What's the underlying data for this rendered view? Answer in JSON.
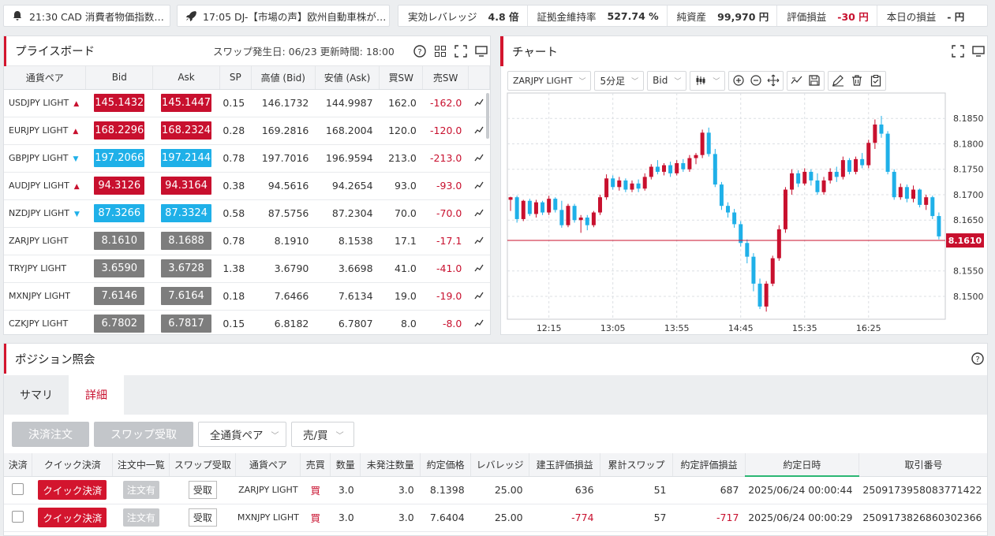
{
  "top": {
    "news1": "21:30 CAD 消費者物価指数…",
    "news2": "17:05 DJ-【市場の声】欧州自動車株が…",
    "stats": [
      {
        "label": "実効レバレッジ",
        "value": "4.8 倍"
      },
      {
        "label": "証拠金維持率",
        "value": "527.74 %"
      },
      {
        "label": "純資産",
        "value": "99,970 円"
      },
      {
        "label": "評価損益",
        "value": "-30 円"
      },
      {
        "label": "本日の損益",
        "value": "- 円"
      }
    ]
  },
  "priceboard": {
    "title": "プライスボード",
    "info": "スワップ発生日: 06/23 更新時間: 18:00",
    "headers": [
      "通貨ペア",
      "Bid",
      "Ask",
      "SP",
      "高値 (Bid)",
      "安値 (Ask)",
      "買SW",
      "売SW",
      ""
    ],
    "rows": [
      {
        "pair": "USDJPY LIGHT",
        "dir": "up",
        "bid": "145.1432",
        "ask": "145.1447",
        "sp": "0.15",
        "high": "146.1732",
        "low": "144.9987",
        "buysw": "162.0",
        "sellsw": "-162.0"
      },
      {
        "pair": "EURJPY LIGHT",
        "dir": "up",
        "bid": "168.2296",
        "ask": "168.2324",
        "sp": "0.28",
        "high": "169.2816",
        "low": "168.2004",
        "buysw": "120.0",
        "sellsw": "-120.0"
      },
      {
        "pair": "GBPJPY LIGHT",
        "dir": "dn",
        "bid": "197.2066",
        "ask": "197.2144",
        "sp": "0.78",
        "high": "197.7016",
        "low": "196.9594",
        "buysw": "213.0",
        "sellsw": "-213.0"
      },
      {
        "pair": "AUDJPY LIGHT",
        "dir": "up",
        "bid": "94.3126",
        "ask": "94.3164",
        "sp": "0.38",
        "high": "94.5616",
        "low": "94.2654",
        "buysw": "93.0",
        "sellsw": "-93.0"
      },
      {
        "pair": "NZDJPY LIGHT",
        "dir": "dn",
        "bid": "87.3266",
        "ask": "87.3324",
        "sp": "0.58",
        "high": "87.5756",
        "low": "87.2304",
        "buysw": "70.0",
        "sellsw": "-70.0"
      },
      {
        "pair": "ZARJPY LIGHT",
        "dir": "nt",
        "bid": "8.1610",
        "ask": "8.1688",
        "sp": "0.78",
        "high": "8.1910",
        "low": "8.1538",
        "buysw": "17.1",
        "sellsw": "-17.1"
      },
      {
        "pair": "TRYJPY LIGHT",
        "dir": "nt",
        "bid": "3.6590",
        "ask": "3.6728",
        "sp": "1.38",
        "high": "3.6790",
        "low": "3.6698",
        "buysw": "41.0",
        "sellsw": "-41.0"
      },
      {
        "pair": "MXNJPY LIGHT",
        "dir": "nt",
        "bid": "7.6146",
        "ask": "7.6164",
        "sp": "0.18",
        "high": "7.6466",
        "low": "7.6134",
        "buysw": "19.0",
        "sellsw": "-19.0"
      },
      {
        "pair": "CZKJPY LIGHT",
        "dir": "nt",
        "bid": "6.7802",
        "ask": "6.7817",
        "sp": "0.15",
        "high": "6.8182",
        "low": "6.7807",
        "buysw": "8.0",
        "sellsw": "-8.0"
      }
    ]
  },
  "chart": {
    "title": "チャート",
    "symbol": "ZARJPY LIGHT",
    "interval": "5分足",
    "side": "Bid",
    "current_price": "8.1610",
    "y_ticks": [
      "8.1850",
      "8.1800",
      "8.1750",
      "8.1700",
      "8.1650",
      "8.1550",
      "8.1500"
    ],
    "x_ticks": [
      "12:15",
      "13:05",
      "13:55",
      "14:45",
      "15:35",
      "16:25"
    ],
    "colors": {
      "up": "#c8102e",
      "down": "#1fb0e8",
      "price_line": "#c8102e"
    }
  },
  "chart_data": {
    "type": "candlestick",
    "title": "",
    "xlabel": "",
    "ylabel": "",
    "ylim": [
      8.1455,
      8.19
    ],
    "x_ticks": [
      "12:15",
      "13:05",
      "13:55",
      "14:45",
      "15:35",
      "16:25"
    ],
    "current": 8.161,
    "candles": [
      [
        8.169,
        8.1696,
        8.1668,
        8.1695
      ],
      [
        8.1695,
        8.1698,
        8.1645,
        8.1652
      ],
      [
        8.1652,
        8.169,
        8.1648,
        8.1688
      ],
      [
        8.1688,
        8.1692,
        8.1658,
        8.1662
      ],
      [
        8.1662,
        8.169,
        8.1655,
        8.1685
      ],
      [
        8.1685,
        8.1688,
        8.166,
        8.1665
      ],
      [
        8.1665,
        8.1698,
        8.166,
        8.1692
      ],
      [
        8.1692,
        8.1695,
        8.1665,
        8.167
      ],
      [
        8.167,
        8.1688,
        8.1635,
        8.164
      ],
      [
        8.164,
        8.1682,
        8.1636,
        8.1678
      ],
      [
        8.1678,
        8.1682,
        8.1645,
        8.165
      ],
      [
        8.165,
        8.166,
        8.1625,
        8.1655
      ],
      [
        8.1655,
        8.166,
        8.163,
        8.164
      ],
      [
        8.164,
        8.1668,
        8.1636,
        8.1665
      ],
      [
        8.1665,
        8.17,
        8.166,
        8.1695
      ],
      [
        8.1695,
        8.174,
        8.169,
        8.1732
      ],
      [
        8.1732,
        8.1738,
        8.171,
        8.1715
      ],
      [
        8.1715,
        8.1735,
        8.1708,
        8.1728
      ],
      [
        8.1728,
        8.1732,
        8.1705,
        8.171
      ],
      [
        8.171,
        8.1728,
        8.1705,
        8.1722
      ],
      [
        8.1722,
        8.173,
        8.1705,
        8.1712
      ],
      [
        8.1712,
        8.1742,
        8.1708,
        8.1735
      ],
      [
        8.1735,
        8.176,
        8.173,
        8.1755
      ],
      [
        8.1755,
        8.1768,
        8.174,
        8.1745
      ],
      [
        8.1745,
        8.1762,
        8.1738,
        8.1758
      ],
      [
        8.1758,
        8.1765,
        8.1735,
        8.1742
      ],
      [
        8.1742,
        8.1768,
        8.1738,
        8.1762
      ],
      [
        8.1762,
        8.177,
        8.1745,
        8.175
      ],
      [
        8.175,
        8.1778,
        8.1745,
        8.1772
      ],
      [
        8.1772,
        8.1782,
        8.176,
        8.1778
      ],
      [
        8.1778,
        8.1828,
        8.1772,
        8.1822
      ],
      [
        8.1822,
        8.1832,
        8.1775,
        8.178
      ],
      [
        8.178,
        8.179,
        8.1715,
        8.172
      ],
      [
        8.172,
        8.1725,
        8.167,
        8.1678
      ],
      [
        8.1678,
        8.1685,
        8.1655,
        8.1665
      ],
      [
        8.1665,
        8.1672,
        8.1635,
        8.1642
      ],
      [
        8.1642,
        8.1648,
        8.1598,
        8.1605
      ],
      [
        8.1605,
        8.1612,
        8.1565,
        8.1578
      ],
      [
        8.1578,
        8.1585,
        8.151,
        8.1525
      ],
      [
        8.1525,
        8.1535,
        8.1475,
        8.148
      ],
      [
        8.148,
        8.153,
        8.147,
        8.1525
      ],
      [
        8.1525,
        8.158,
        8.152,
        8.1575
      ],
      [
        8.1575,
        8.164,
        8.157,
        8.1632
      ],
      [
        8.1632,
        8.1715,
        8.1625,
        8.171
      ],
      [
        8.171,
        8.175,
        8.17,
        8.1742
      ],
      [
        8.1742,
        8.1748,
        8.1715,
        8.1722
      ],
      [
        8.1722,
        8.1752,
        8.1718,
        8.1745
      ],
      [
        8.1745,
        8.175,
        8.1718,
        8.1728
      ],
      [
        8.1728,
        8.1742,
        8.17,
        8.1705
      ],
      [
        8.1705,
        8.1735,
        8.17,
        8.1728
      ],
      [
        8.1728,
        8.1752,
        8.1722,
        8.1745
      ],
      [
        8.1745,
        8.1755,
        8.1725,
        8.1735
      ],
      [
        8.1735,
        8.1775,
        8.173,
        8.1768
      ],
      [
        8.1768,
        8.1772,
        8.174,
        8.1745
      ],
      [
        8.1745,
        8.1775,
        8.174,
        8.177
      ],
      [
        8.177,
        8.1782,
        8.1752,
        8.1758
      ],
      [
        8.1758,
        8.1808,
        8.1752,
        8.1802
      ],
      [
        8.1802,
        8.1848,
        8.179,
        8.1838
      ],
      [
        8.1838,
        8.1855,
        8.1812,
        8.182
      ],
      [
        8.182,
        8.1825,
        8.174,
        8.1745
      ],
      [
        8.1745,
        8.175,
        8.169,
        8.1695
      ],
      [
        8.1695,
        8.1722,
        8.169,
        8.1715
      ],
      [
        8.1715,
        8.172,
        8.1685,
        8.1692
      ],
      [
        8.1692,
        8.1718,
        8.1685,
        8.171
      ],
      [
        8.171,
        8.1712,
        8.1675,
        8.168
      ],
      [
        8.168,
        8.17,
        8.167,
        8.1695
      ],
      [
        8.1695,
        8.1698,
        8.1652,
        8.1658
      ],
      [
        8.1658,
        8.1665,
        8.1612,
        8.1618
      ]
    ]
  },
  "positions": {
    "title": "ポジション照会",
    "tabs": [
      "サマリ",
      "詳細"
    ],
    "btn_settle": "決済注文",
    "btn_swap": "スワップ受取",
    "filter_pair": "全通貨ペア",
    "filter_side": "売/買",
    "headers": [
      "決済",
      "クイック決済",
      "注文中一覧",
      "スワップ受取",
      "通貨ペア",
      "売買",
      "数量",
      "未発注数量",
      "約定価格",
      "レバレッジ",
      "建玉評価損益",
      "累計スワップ",
      "約定評価損益",
      "約定日時",
      "取引番号"
    ],
    "quick_label": "クイック決済",
    "order_label": "注文有",
    "receive_label": "受取",
    "rows": [
      {
        "pair": "ZARJPY LIGHT",
        "side": "買",
        "qty": "3.0",
        "unfilled": "3.0",
        "price": "8.1398",
        "lev": "25.00",
        "pnl": "636",
        "swap": "51",
        "total": "687",
        "dt": "2025/06/24 00:00:44",
        "id": "2509173958083771422"
      },
      {
        "pair": "MXNJPY LIGHT",
        "side": "買",
        "qty": "3.0",
        "unfilled": "3.0",
        "price": "7.6404",
        "lev": "25.00",
        "pnl": "-774",
        "swap": "57",
        "total": "-717",
        "dt": "2025/06/24 00:00:29",
        "id": "2509173826860302366"
      }
    ]
  }
}
